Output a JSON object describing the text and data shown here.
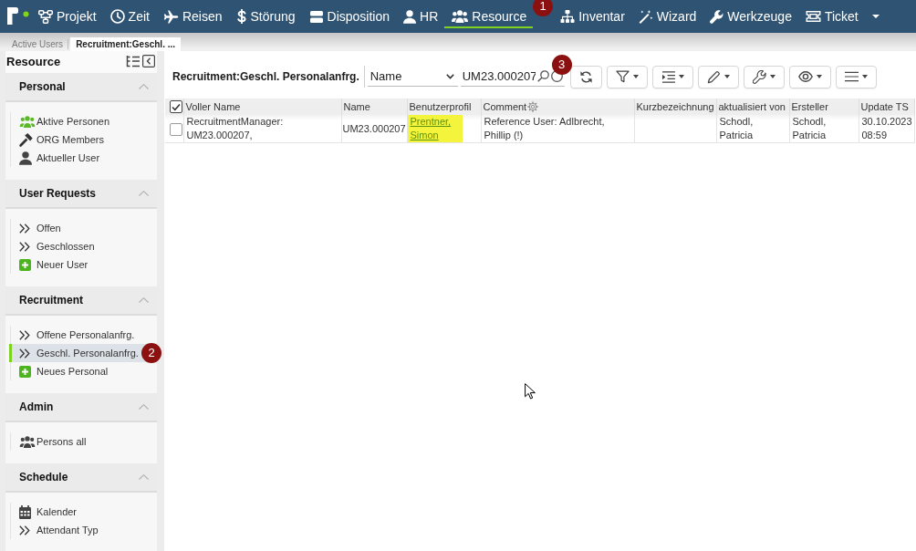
{
  "topbar": {
    "nav": [
      {
        "label": "Projekt",
        "selected": false
      },
      {
        "label": "Zeit",
        "selected": false
      },
      {
        "label": "Reisen",
        "selected": false
      },
      {
        "label": "Störung",
        "selected": false
      },
      {
        "label": "Disposition",
        "selected": false
      },
      {
        "label": "HR",
        "selected": false
      },
      {
        "label": "Resource",
        "selected": true,
        "callout": "1"
      },
      {
        "label": "Inventar",
        "selected": false
      },
      {
        "label": "Wizard",
        "selected": false
      },
      {
        "label": "Werkzeuge",
        "selected": false
      },
      {
        "label": "Ticket",
        "selected": false
      }
    ]
  },
  "tabs": [
    {
      "label": "Active Users",
      "selected": false
    },
    {
      "label": "Recruitment:Geschl. ...",
      "selected": true
    }
  ],
  "sidebar": {
    "title": "Resource",
    "sections": [
      {
        "title": "Personal",
        "expanded": true,
        "items": [
          {
            "label": "Aktive Personen",
            "selected": false
          },
          {
            "label": "ORG Members",
            "selected": false
          },
          {
            "label": "Aktueller User",
            "selected": false
          }
        ]
      },
      {
        "title": "User Requests",
        "expanded": true,
        "items": [
          {
            "label": "Offen",
            "selected": false
          },
          {
            "label": "Geschlossen",
            "selected": false
          },
          {
            "label": "Neuer User",
            "selected": false
          }
        ]
      },
      {
        "title": "Recruitment",
        "expanded": true,
        "items": [
          {
            "label": "Offene Personalanfrg.",
            "selected": false
          },
          {
            "label": "Geschl. Personalanfrg.",
            "selected": true,
            "callout": "2"
          },
          {
            "label": "Neues Personal",
            "selected": false
          }
        ]
      },
      {
        "title": "Admin",
        "expanded": true,
        "items": [
          {
            "label": "Persons all",
            "selected": false
          }
        ]
      },
      {
        "title": "Schedule",
        "expanded": true,
        "items": [
          {
            "label": "Kalender",
            "selected": false
          },
          {
            "label": "Attendant Typ",
            "selected": false
          }
        ]
      }
    ]
  },
  "main": {
    "title": "Recruitment:Geschl. Personalanfrg.",
    "column_select": {
      "value": "Name"
    },
    "search": {
      "value": "UM23.000207",
      "callout": "3"
    },
    "toolbar_buttons": [
      {
        "dropdown": false
      },
      {
        "dropdown": true
      },
      {
        "dropdown": true
      },
      {
        "dropdown": true
      },
      {
        "dropdown": true
      },
      {
        "dropdown": true
      },
      {
        "dropdown": true
      }
    ],
    "table": {
      "header_checkbox": {
        "checked": true
      },
      "columns": [
        {
          "label": "Voller Name"
        },
        {
          "label": "Name"
        },
        {
          "label": "Benutzerprofil"
        },
        {
          "label": "Comment",
          "settings": true
        },
        {
          "label": "Kurzbezeichnung"
        },
        {
          "label": "aktualisiert von"
        },
        {
          "label": "Ersteller"
        },
        {
          "label": "Update TS"
        }
      ],
      "rows": [
        {
          "checked": false,
          "voller_name": "RecruitmentManager: UM23.000207,",
          "name": "UM23.000207",
          "benutzerprofil": {
            "text": "Prentner, Simon",
            "link": true,
            "highlighted": true
          },
          "comment": "Reference User: Adlbrecht, Phillip (!)",
          "aktualisiert_von": "Schodl, Patricia",
          "ersteller": "Schodl, Patricia",
          "update_ts": "30.10.2023 08:59"
        }
      ]
    }
  }
}
